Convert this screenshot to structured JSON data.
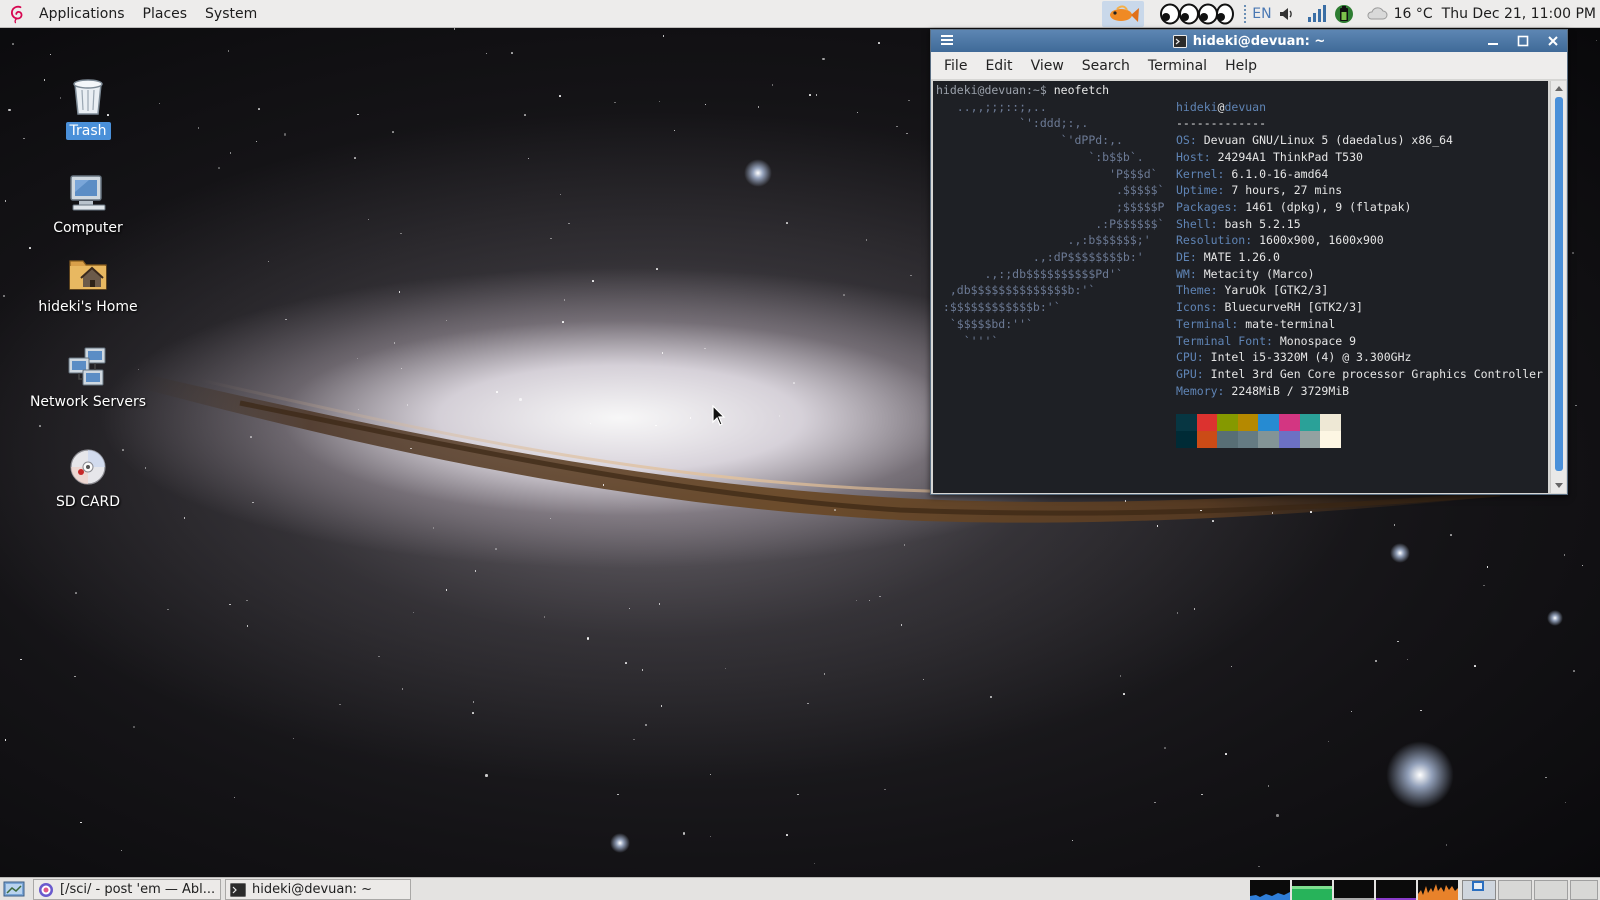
{
  "top_panel": {
    "menus": [
      "Applications",
      "Places",
      "System"
    ],
    "tray": {
      "keyboard_layout": "EN",
      "temperature": "16 °C",
      "clock": "Thu Dec 21, 11:00 PM"
    }
  },
  "desktop": {
    "icons": [
      {
        "label": "Trash",
        "icon": "trash-icon",
        "selected": true
      },
      {
        "label": "Computer",
        "icon": "computer-icon",
        "selected": false
      },
      {
        "label": "hideki's Home",
        "icon": "home-folder-icon",
        "selected": false
      },
      {
        "label": "Network Servers",
        "icon": "network-icon",
        "selected": false
      },
      {
        "label": "SD CARD",
        "icon": "disc-icon",
        "selected": false
      }
    ]
  },
  "terminal": {
    "title": "hideki@devuan: ~",
    "menu": [
      "File",
      "Edit",
      "View",
      "Search",
      "Terminal",
      "Help"
    ],
    "prompt": "hideki@devuan:~$",
    "command": "neofetch",
    "ascii_art": [
      "   ..,,;;;::;,..",
      "            `':ddd;:,.",
      "                  `'dPPd:,.",
      "                      `:b$$b`.",
      "                         'P$$$d`",
      "                          .$$$$$`",
      "                          ;$$$$$P",
      "                       .:P$$$$$$`",
      "                   .,:b$$$$$$;'",
      "              .,:dP$$$$$$$$b:'",
      "       .,:;db$$$$$$$$$$Pd'`",
      "  ,db$$$$$$$$$$$$$$b:'`",
      " :$$$$$$$$$$$$b:'`",
      "  `$$$$$bd:''`",
      "    `'''`"
    ],
    "neofetch": {
      "user": "hideki",
      "at": "@",
      "host": "devuan",
      "separator": "-------------",
      "rows": [
        {
          "key": "OS",
          "value": "Devuan GNU/Linux 5 (daedalus) x86_64"
        },
        {
          "key": "Host",
          "value": "24294A1 ThinkPad T530"
        },
        {
          "key": "Kernel",
          "value": "6.1.0-16-amd64"
        },
        {
          "key": "Uptime",
          "value": "7 hours, 27 mins"
        },
        {
          "key": "Packages",
          "value": "1461 (dpkg), 9 (flatpak)"
        },
        {
          "key": "Shell",
          "value": "bash 5.2.15"
        },
        {
          "key": "Resolution",
          "value": "1600x900, 1600x900"
        },
        {
          "key": "DE",
          "value": "MATE 1.26.0"
        },
        {
          "key": "WM",
          "value": "Metacity (Marco)"
        },
        {
          "key": "Theme",
          "value": "YaruOk [GTK2/3]"
        },
        {
          "key": "Icons",
          "value": "BluecurveRH [GTK2/3]"
        },
        {
          "key": "Terminal",
          "value": "mate-terminal"
        },
        {
          "key": "Terminal Font",
          "value": "Monospace 9"
        },
        {
          "key": "CPU",
          "value": "Intel i5-3320M (4) @ 3.300GHz"
        },
        {
          "key": "GPU",
          "value": "Intel 3rd Gen Core processor Graphics Controller"
        },
        {
          "key": "Memory",
          "value": "2248MiB / 3729MiB"
        }
      ],
      "palette_top": [
        "#073642",
        "#dc322f",
        "#859900",
        "#b58900",
        "#268bd2",
        "#d33682",
        "#2aa198",
        "#eee8d5"
      ],
      "palette_bottom": [
        "#002b36",
        "#cb4b16",
        "#586e75",
        "#657b83",
        "#839496",
        "#6c71c4",
        "#93a1a1",
        "#fdf6e3"
      ]
    }
  },
  "taskbar": {
    "tasks": [
      {
        "label": "[/sci/ - post 'em — Abl...",
        "icon": "browser-icon"
      },
      {
        "label": "hideki@devuan: ~",
        "icon": "terminal-icon"
      }
    ]
  },
  "colors": {
    "titlebar": "#4a76a8",
    "selection": "#4a90d9",
    "panel": "#edeceb"
  }
}
